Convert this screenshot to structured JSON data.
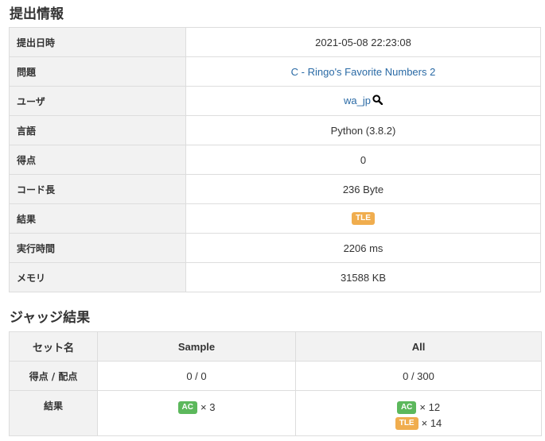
{
  "sections": {
    "submission_info": "提出情報",
    "judge_result": "ジャッジ結果"
  },
  "info": {
    "submit_time": {
      "label": "提出日時",
      "value": "2021-05-08 22:23:08"
    },
    "problem": {
      "label": "問題",
      "value": "C - Ringo's Favorite Numbers 2"
    },
    "user": {
      "label": "ユーザ",
      "value": "wa_jp"
    },
    "language": {
      "label": "言語",
      "value": "Python (3.8.2)"
    },
    "score": {
      "label": "得点",
      "value": "0"
    },
    "code_length": {
      "label": "コード長",
      "value": "236 Byte"
    },
    "result": {
      "label": "結果",
      "value": "TLE"
    },
    "exec_time": {
      "label": "実行時間",
      "value": "2206 ms"
    },
    "memory": {
      "label": "メモリ",
      "value": "31588 KB"
    }
  },
  "judge": {
    "headers": {
      "set_name": "セット名",
      "sample": "Sample",
      "all": "All"
    },
    "score_row": {
      "label": "得点 / 配点",
      "sample": "0 / 0",
      "all": "0 / 300"
    },
    "result_row": {
      "label": "結果",
      "sample": [
        {
          "status": "AC",
          "count": "× 3"
        }
      ],
      "all": [
        {
          "status": "AC",
          "count": "× 12"
        },
        {
          "status": "TLE",
          "count": "× 14"
        }
      ]
    }
  },
  "colors": {
    "link": "#2a6aa5",
    "ac": "#5cb85c",
    "tle": "#f0ad4e",
    "header_bg": "#f2f2f2"
  },
  "icons": {
    "user_search": "search-icon"
  }
}
